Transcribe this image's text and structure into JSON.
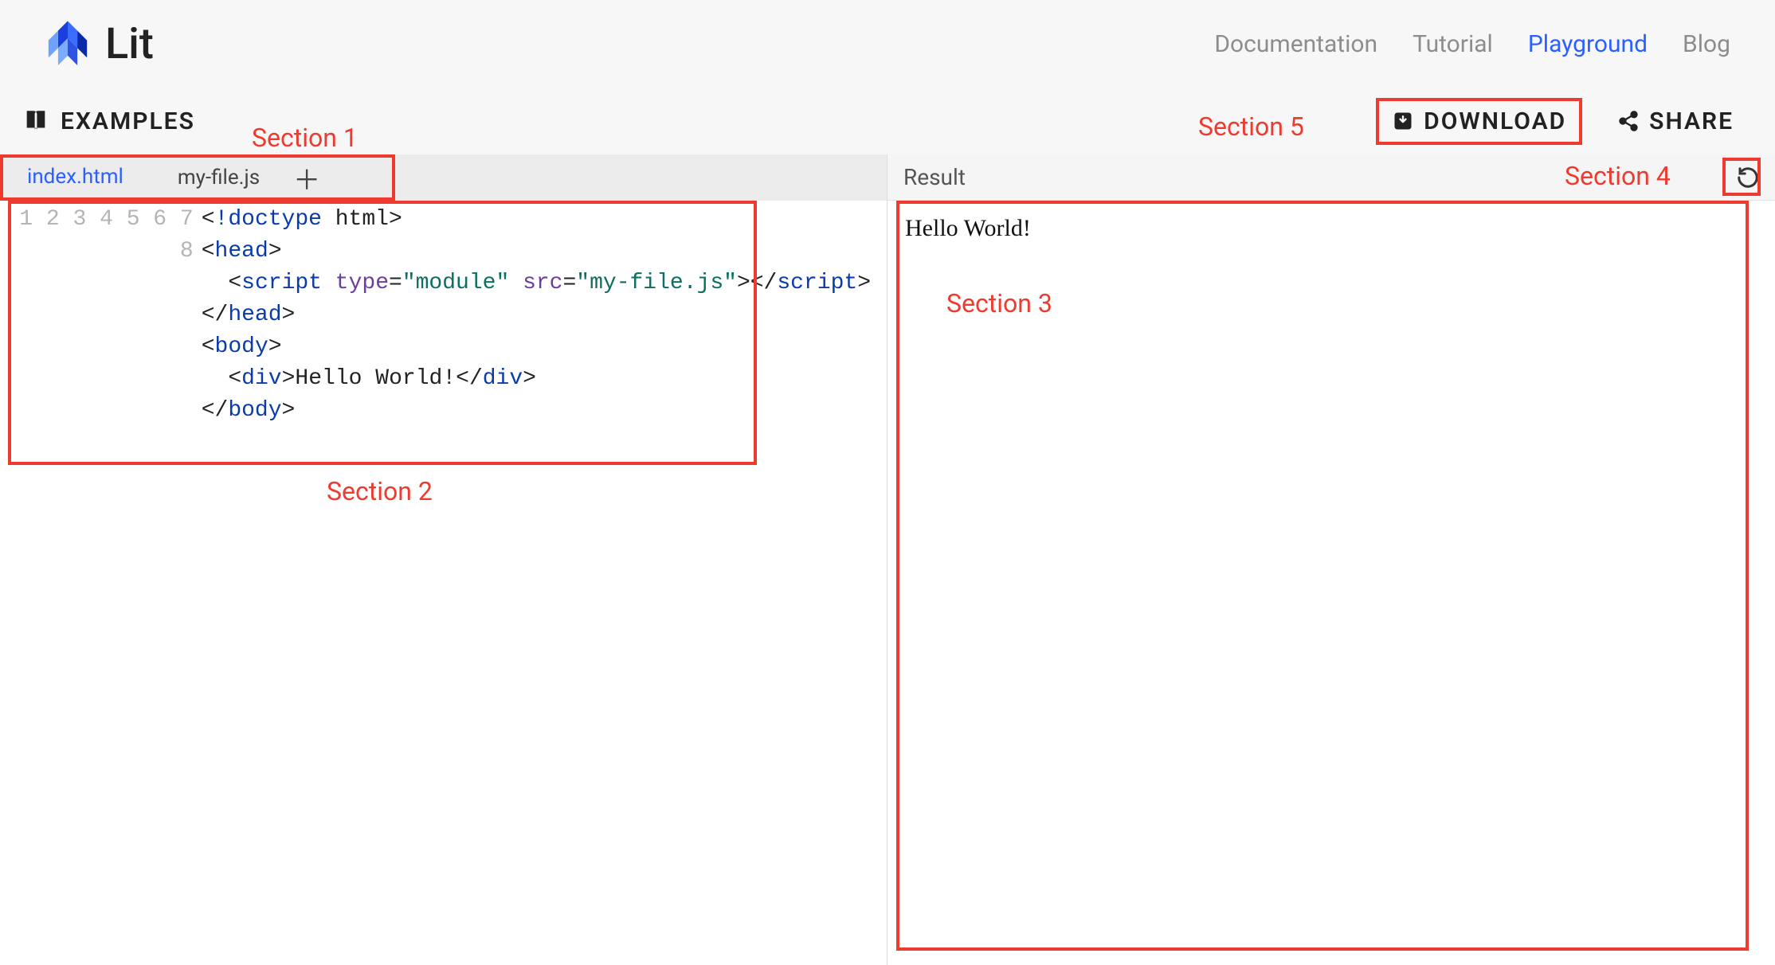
{
  "brand": {
    "name": "Lit"
  },
  "nav": {
    "documentation": "Documentation",
    "tutorial": "Tutorial",
    "playground": "Playground",
    "blog": "Blog"
  },
  "toolbar": {
    "examples": "EXAMPLES",
    "download": "DOWNLOAD",
    "share": "SHARE"
  },
  "tabs": {
    "active": "index.html",
    "second": "my-file.js"
  },
  "editor": {
    "line_numbers": [
      "1",
      "2",
      "3",
      "4",
      "5",
      "6",
      "7",
      "8"
    ],
    "lines_plain": [
      "<!doctype html>",
      "<head>",
      "  <script type=\"module\" src=\"my-file.js\"></script>",
      "</head>",
      "<body>",
      "  <div>Hello World!</div>",
      "</body>",
      ""
    ]
  },
  "result": {
    "title": "Result",
    "output": "Hello World!"
  },
  "annotations": {
    "s1": "Section 1",
    "s2": "Section 2",
    "s3": "Section 3",
    "s4": "Section 4",
    "s5": "Section 5"
  },
  "colors": {
    "accent": "#2b5fff",
    "annotation": "#ee3a2f"
  }
}
